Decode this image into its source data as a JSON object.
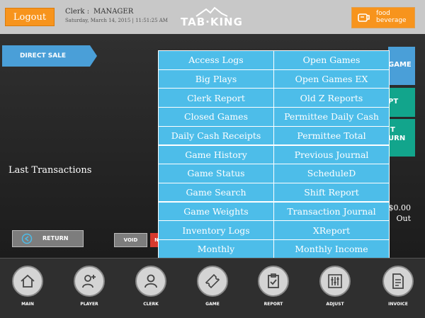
{
  "header": {
    "logout_label": "Logout",
    "clerk_label": "Clerk :",
    "clerk_name": "MANAGER",
    "datetime": "Saturday, March 14, 2015 | 11:51:25 AM",
    "logo_text": "TAB·KING",
    "food_line1": "food",
    "food_line2": "beverage"
  },
  "main": {
    "direct_sale_label": "DIRECT SALE",
    "last_transactions_label": "Last Transactions",
    "right_buttons": [
      {
        "label": "GAME",
        "color": "#4a9fd8"
      },
      {
        "label": "PT",
        "color": "#12a58c"
      },
      {
        "label_line1": "T",
        "label_line2": "URN",
        "color": "#12a58c"
      }
    ],
    "amount": "$0.00",
    "amount_label": "Out",
    "return_label": "RETURN",
    "void_label": "VOID",
    "red_button_label": "N"
  },
  "menu": {
    "left": [
      "Access Logs",
      "Big Plays",
      "Clerk Report",
      "Closed Games",
      "Daily Cash Receipts",
      "Game History",
      "Game Status",
      "Game Search",
      "Game Weights",
      "Inventory Logs",
      "Monthly"
    ],
    "right": [
      "Open Games",
      "Open Games EX",
      "Old Z Reports",
      "Permittee Daily Cash",
      "Permittee Total",
      "Previous Journal",
      "ScheduleD",
      "Shift Report",
      "Transaction Journal",
      "XReport",
      "Monthly Income"
    ],
    "item_color": "#4dbde9"
  },
  "nav": {
    "items": [
      {
        "label": "MAIN",
        "icon": "home-icon"
      },
      {
        "label": "PLAYER",
        "icon": "add-user-icon"
      },
      {
        "label": "CLERK",
        "icon": "user-icon"
      },
      {
        "label": "GAME",
        "icon": "ticket-icon"
      },
      {
        "label": "REPORT",
        "icon": "clipboard-check-icon"
      },
      {
        "label": "ADJUST",
        "icon": "sliders-icon"
      },
      {
        "label": "INVOICE",
        "icon": "document-icon"
      }
    ]
  },
  "colors": {
    "accent_orange": "#f7941d",
    "accent_blue": "#4dbde9",
    "direct_sale": "#4a9fd8"
  }
}
